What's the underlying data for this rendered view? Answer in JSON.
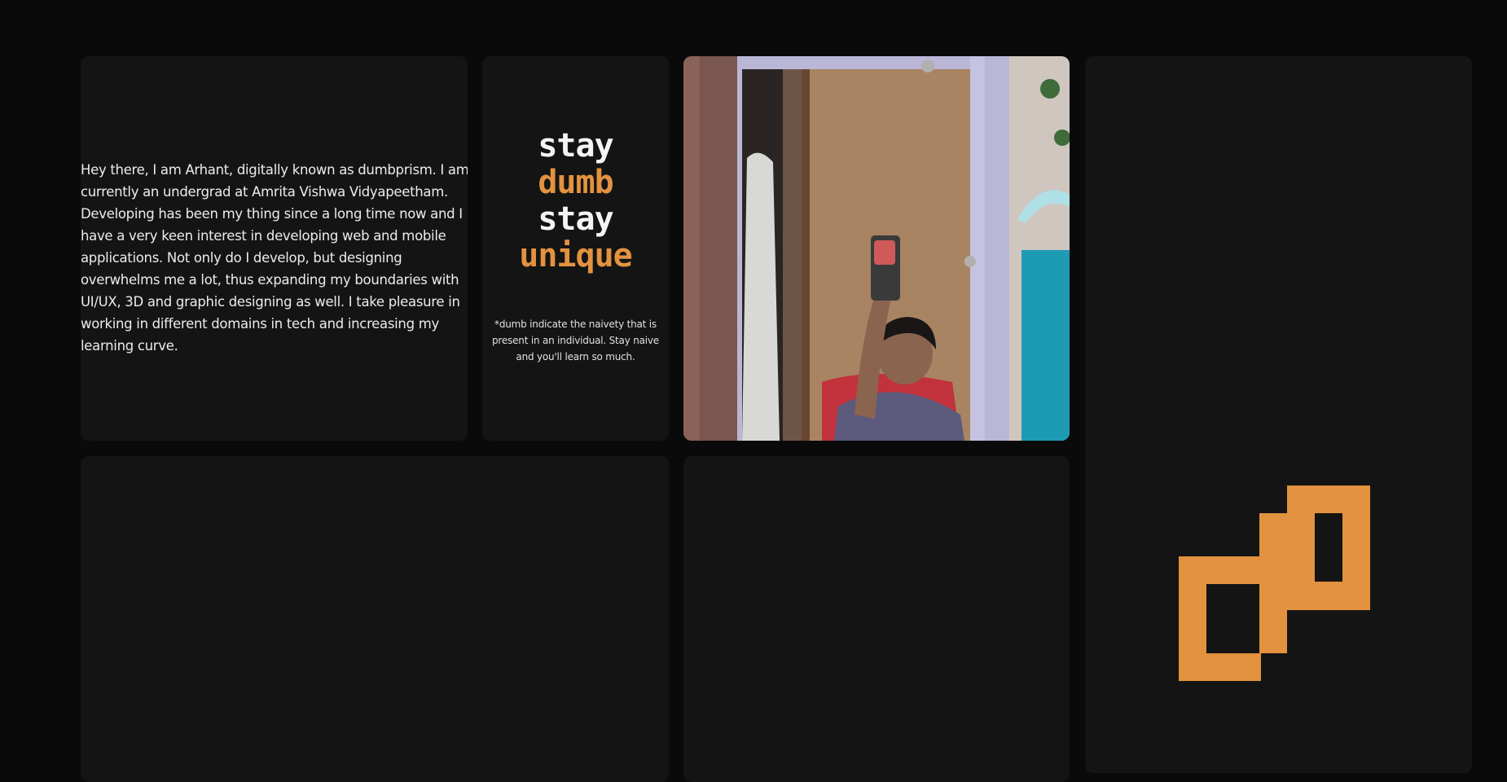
{
  "bio": {
    "text": "Hey there, I am Arhant, digitally known as dumbprism. I am currently an undergrad at Amrita Vishwa Vidyapeetham. Developing has been my thing since a long time now and I have a very keen interest in developing web and mobile applications. Not only do I develop, but designing overwhelms me a lot, thus expanding my boundaries with UI/UX, 3D and graphic designing as well. I take pleasure in working in different domains in tech and increasing my learning curve."
  },
  "motto": {
    "line1": "stay",
    "line2": "dumb",
    "line3": "stay",
    "line4": "unique",
    "footnote": "*dumb indicate the naivety that is present in an individual. Stay naive and you'll learn so much."
  },
  "photo": {
    "icon": "mirror-selfie-photo"
  },
  "logo": {
    "icon": "dumbprism-logo-icon",
    "color": "#e3923f"
  },
  "colors": {
    "background": "#0a0a0a",
    "card": "#141414",
    "accent": "#e3923f"
  }
}
